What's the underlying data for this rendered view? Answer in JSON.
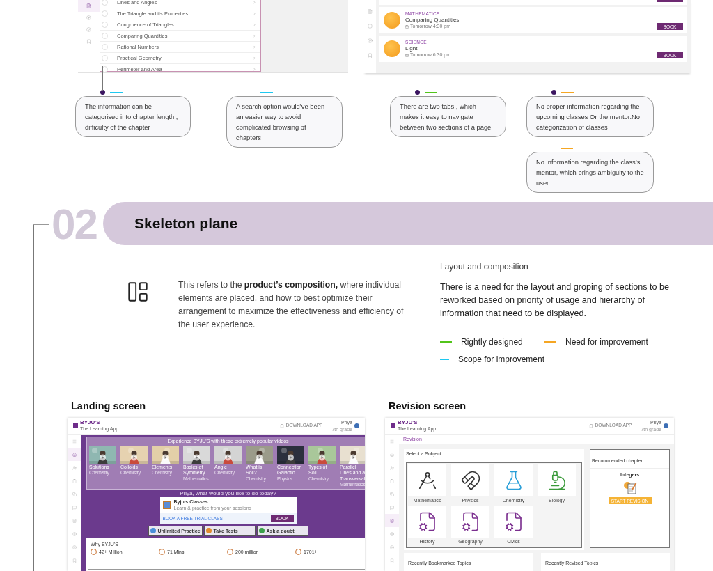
{
  "top_mocks": {
    "chapters_screen": {
      "sidebar": [
        {
          "kind": "doc",
          "selected": true
        },
        {
          "kind": "plus",
          "selected": false
        },
        {
          "kind": "play",
          "selected": false
        },
        {
          "kind": "bookmark",
          "selected": false
        }
      ],
      "chapters": [
        {
          "title": "Lines and Angles"
        },
        {
          "title": "The Triangle and its Properties"
        },
        {
          "title": "Congruence of Triangles"
        },
        {
          "title": "Comparing Quantities"
        },
        {
          "title": "Rational Numbers"
        },
        {
          "title": "Practical Geometry"
        },
        {
          "title": "Perimeter and Area"
        }
      ]
    },
    "classes_screen": {
      "sidebar": [
        {
          "kind": "doc",
          "selected": false
        },
        {
          "kind": "plus",
          "selected": false
        },
        {
          "kind": "play",
          "selected": false
        },
        {
          "kind": "bookmark",
          "selected": false
        }
      ],
      "classes": [
        {
          "subject": "MATHEMATICS",
          "title": "Comparing Quantities",
          "time": "Tomorrow 4:30 pm",
          "button": "BOOK"
        },
        {
          "subject": "SCIENCE",
          "title": "Light",
          "time": "Tomorrow 6:30 pm",
          "button": "BOOK"
        }
      ]
    }
  },
  "callouts": [
    {
      "dot": true,
      "notes": [
        {
          "color": "#1ec8f0",
          "text": "The information can be categorised into chapter length , difficulty of the chapter"
        }
      ]
    },
    {
      "dot": false,
      "notes": [
        {
          "color": "#1ec8f0",
          "text": "A search option would’ve been an easier way to avoid complicated browsing of chapters"
        }
      ]
    },
    {
      "dot": true,
      "notes": [
        {
          "color": "#52c41a",
          "text": "There are two tabs , which makes it easy to navigate between two sections of a page."
        }
      ]
    },
    {
      "dot": true,
      "notes": [
        {
          "color": "#f5a623",
          "text": "No proper information regarding the upcoming classes Or the mentor.No categorization of classes"
        },
        {
          "color": "#f5a623",
          "text": "No information regarding the class’s mentor, which brings ambiguity to the user."
        }
      ]
    }
  ],
  "section": {
    "number": "02",
    "title": "Skeleton plane"
  },
  "description": {
    "text": "This refers to the **product’s composition,** where individual elements are placed, and how to best optimize their arrangement to maximize the effectiveness and efficiency of the user experience."
  },
  "findings": {
    "title": "Layout and composition",
    "text": "There is a need for the layout and groping of sections to be reworked based on priority of usage and hierarchy of information that need to be displayed.",
    "legend": [
      {
        "color": "#52c41a",
        "label": "Rightly designed"
      },
      {
        "color": "#f5a623",
        "label": "Need for improvement"
      },
      {
        "color": "#1ec8f0",
        "label": "Scope for improvement"
      }
    ]
  },
  "screens": [
    {
      "kind": "landing",
      "title": "Landing screen",
      "header": {
        "logo": "BYJU'S",
        "tagline": "The Learning App",
        "download": "DOWNLOAD APP",
        "user": "Priya",
        "grade": "7th grade"
      },
      "sidebar": [
        {
          "kind": "menu",
          "selected": false
        },
        {
          "kind": "home",
          "selected": true
        },
        {
          "kind": "user",
          "selected": false
        },
        {
          "kind": "clipboard",
          "selected": false
        },
        {
          "kind": "copy",
          "selected": false
        },
        {
          "kind": "message",
          "selected": false
        },
        {
          "kind": "doc",
          "selected": false
        },
        {
          "kind": "plus",
          "selected": false
        },
        {
          "kind": "play",
          "selected": false
        },
        {
          "kind": "bookmark",
          "selected": false
        }
      ],
      "videos_title": "Experience BYJU'S with these extremely popular videos",
      "videos": [
        {
          "kind": "picture",
          "title": "Solutions",
          "subject": "Chemistry"
        },
        {
          "kind": "picture",
          "title": "Colloids",
          "subject": "Chemistry"
        },
        {
          "kind": "picture",
          "title": "Elements",
          "subject": "Chemistry"
        },
        {
          "kind": "picture",
          "title": "Basics of Symmetry",
          "subject": "Mathematics"
        },
        {
          "kind": "picture",
          "title": "Angle",
          "subject": "Chemistry"
        },
        {
          "kind": "picture",
          "title": "What is Soil?",
          "subject": "Chemistry"
        },
        {
          "kind": "picture",
          "title": "Connection Galactic",
          "subject": "Physics"
        },
        {
          "kind": "picture",
          "title": "Types of Soil",
          "subject": "Chemistry"
        },
        {
          "kind": "picture",
          "title": "Parallel Lines and a Transversal",
          "subject": "Mathematics"
        }
      ],
      "greeting": "Priya, what would you like to do today?",
      "classes_card": {
        "title": "Byju's Classes",
        "subtitle": "Learn & practice from your sessions",
        "link": "BOOK A FREE TRIAL CLASS",
        "button": "BOOK"
      },
      "features": [
        {
          "title": "Unlimited Practice"
        },
        {
          "title": "Take Tests"
        },
        {
          "title": "Ask a doubt"
        }
      ],
      "why": {
        "title": "Why BYJU'S",
        "stats": [
          "42+ Million",
          "71 Mins",
          "200 million",
          "1701+"
        ]
      }
    },
    {
      "kind": "revision",
      "title": "Revision screen",
      "header": {
        "logo": "BYJU'S",
        "tagline": "The Learning App",
        "download": "DOWNLOAD APP",
        "user": "Priya",
        "grade": "7th grade"
      },
      "sidebar": [
        {
          "kind": "menu",
          "selected": false
        },
        {
          "kind": "home",
          "selected": false
        },
        {
          "kind": "user",
          "selected": false
        },
        {
          "kind": "clipboard",
          "selected": false
        },
        {
          "kind": "copy",
          "selected": false
        },
        {
          "kind": "message",
          "selected": false
        },
        {
          "kind": "doc",
          "selected": true
        },
        {
          "kind": "plus",
          "selected": false
        },
        {
          "kind": "play",
          "selected": false
        },
        {
          "kind": "bookmark",
          "selected": false
        }
      ],
      "page_title": "Revision",
      "subjects_title": "Select a Subject",
      "subjects": [
        {
          "kind": "compass",
          "name": "Mathematics"
        },
        {
          "kind": "magnet",
          "name": "Physics"
        },
        {
          "kind": "flask",
          "name": "Chemistry"
        },
        {
          "kind": "microscope",
          "name": "Biology"
        },
        {
          "kind": "docs",
          "name": "History"
        },
        {
          "kind": "docs",
          "name": "Geography"
        },
        {
          "kind": "docs",
          "name": "Civics"
        }
      ],
      "recommended": {
        "title": "Recommended chapter",
        "chapter": "Integers",
        "button": "START REVISION"
      },
      "panels": [
        "Recently Bookmarked Topics",
        "Recently Revised Topics"
      ]
    }
  ]
}
